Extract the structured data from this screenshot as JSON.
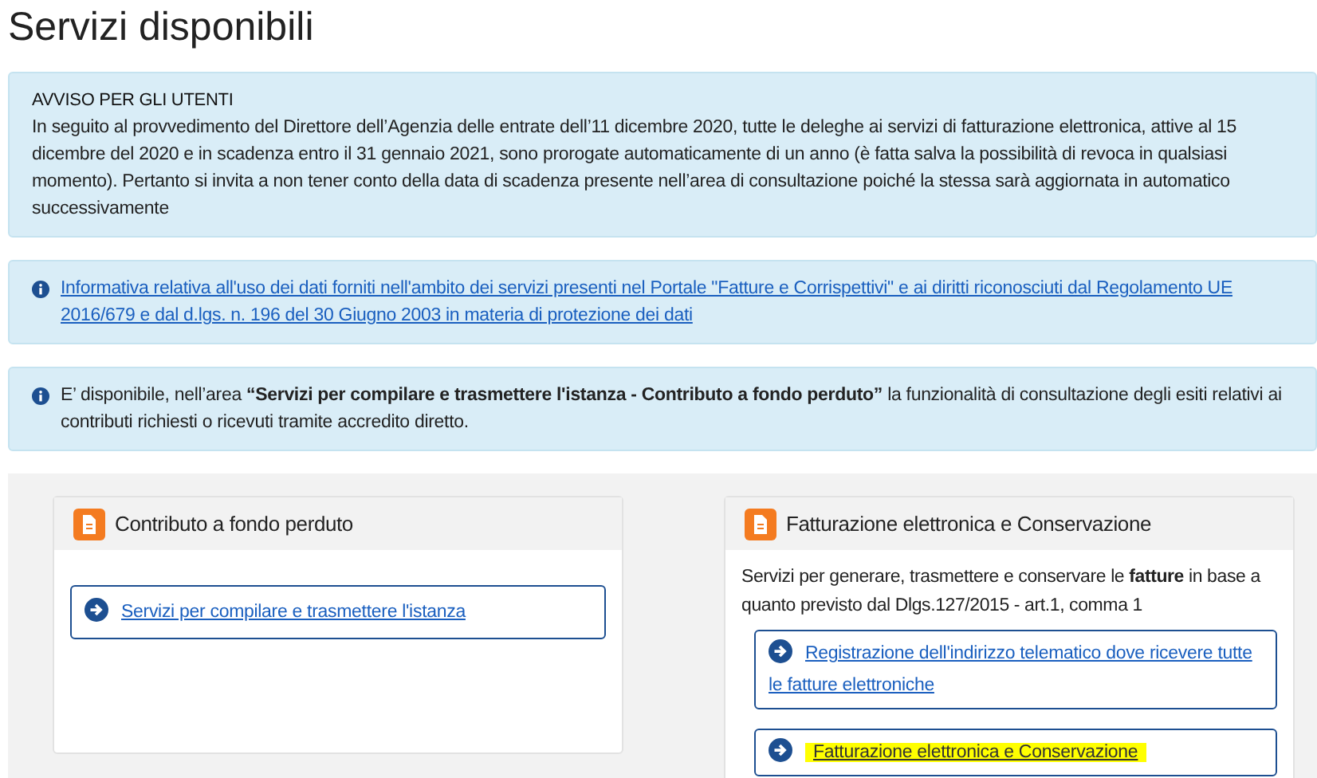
{
  "title": "Servizi disponibili",
  "notices": [
    {
      "kind": "notice",
      "heading": "AVVISO PER GLI UTENTI",
      "text": "In seguito al provvedimento del Direttore dell’Agenzia delle entrate dell’11 dicembre 2020, tutte le deleghe ai servizi di fatturazione elettronica, attive al 15 dicembre del 2020 e in scadenza entro il 31 gennaio 2021, sono prorogate automaticamente di un anno (è fatta salva la possibilità di revoca in qualsiasi momento). Pertanto si invita a non tener conto della data di scadenza presente nell’area di consultazione poiché la stessa sarà aggiornata in automatico successivamente"
    },
    {
      "kind": "link",
      "text": "Informativa relativa all'uso dei dati forniti nell'ambito dei servizi presenti nel Portale \"Fatture e Corrispettivi\" e ai diritti riconosciuti dal Regolamento UE 2016/679 e dal d.lgs. n. 196 del 30 Giugno 2003 in materia di protezione dei dati"
    },
    {
      "kind": "info",
      "text": "E’ disponibile, nell’area **“Servizi per compilare e trasmettere l'istanza - Contributo a fondo perduto”** la funzionalità di consultazione degli esiti relativi ai contributi richiesti o ricevuti tramite accredito diretto."
    }
  ],
  "cards": [
    {
      "title": "Contributo a fondo perduto",
      "links": [
        {
          "text": "Servizi per compilare e trasmettere l'istanza",
          "highlighted": false
        }
      ]
    },
    {
      "title": "Fatturazione elettronica e Conservazione",
      "description": "Servizi per generare, trasmettere e conservare le **fatture** in base a quanto previsto dal Dlgs.127/2015 - art.1, comma 1",
      "links": [
        {
          "text": "Registrazione dell'indirizzo telematico dove ricevere tutte le fatture elettroniche",
          "highlighted": false
        },
        {
          "text": "Fatturazione elettronica e Conservazione",
          "highlighted": true
        }
      ]
    }
  ]
}
